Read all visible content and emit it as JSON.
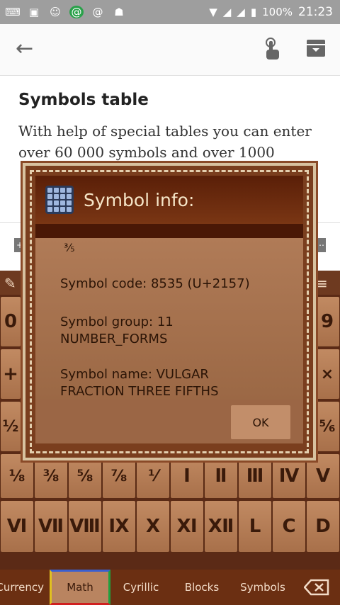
{
  "status_bar": {
    "icons": [
      "keyboard-icon",
      "image-icon",
      "chat-icon",
      "at-icon",
      "at-outline-icon",
      "android-icon"
    ],
    "battery": "100%",
    "time": "21:23"
  },
  "app_bar": {
    "back_icon": "arrow-back-icon",
    "touch_icon": "touch-icon",
    "archive_icon": "archive-icon"
  },
  "content": {
    "title": "Symbols table",
    "body": "With help of special tables you can enter over 60 000 symbols and over 1000"
  },
  "dialog": {
    "title": "Symbol info:",
    "symbol": "⅗",
    "code": "Symbol code: 8535 (U+2157)",
    "group_line1": "Symbol group: 11",
    "group_line2": "NUMBER_FORMS",
    "name_line1": "Symbol name: VULGAR",
    "name_line2": "FRACTION THREE FIFTHS",
    "ok": "OK"
  },
  "keyboard": {
    "row_top_left": [
      "0",
      "+",
      "½"
    ],
    "row_top_right": [
      "9",
      "×",
      "⅚"
    ],
    "row_fractions": [
      "⅛",
      "⅜",
      "⅝",
      "⅞",
      "⅟",
      "Ⅰ",
      "Ⅱ",
      "Ⅲ",
      "Ⅳ",
      "Ⅴ"
    ],
    "row_roman": [
      "Ⅵ",
      "Ⅶ",
      "Ⅷ",
      "Ⅸ",
      "Ⅹ",
      "Ⅺ",
      "Ⅻ",
      "Ⅼ",
      "Ⅽ",
      "Ⅾ"
    ],
    "tabs": [
      "Currency",
      "Math",
      "Cyrillic",
      "Blocks",
      "Symbols"
    ],
    "active_tab": "Math",
    "backspace_icon": "backspace-icon",
    "colors": {
      "key": "#b37a52",
      "bg": "#5b2a16"
    }
  }
}
